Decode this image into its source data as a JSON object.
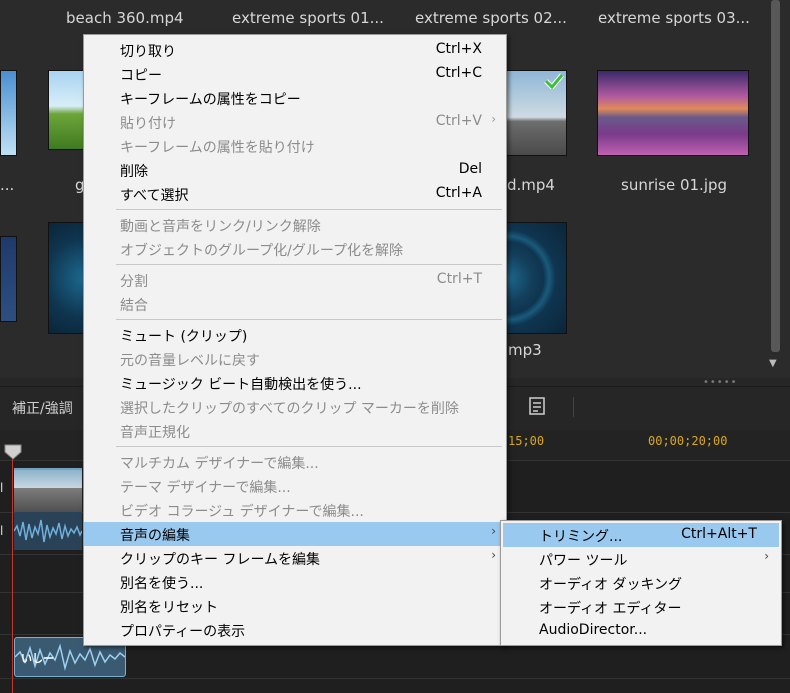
{
  "media": {
    "titles": [
      "beach 360.mp4",
      "extreme sports 01...",
      "extreme sports 02...",
      "extreme sports 03..."
    ],
    "captions": {
      "partial_left": "...",
      "partial_g": "g",
      "partial_mp4": "d.mp4",
      "sunrise": "sunrise 01.jpg",
      "partial_mp3": "mp3"
    }
  },
  "toolbar": {
    "label": "補正/強調"
  },
  "timeline": {
    "ruler_labels": [
      "15;00",
      "00;00;20;00"
    ],
    "audio_clip_label": "いしー"
  },
  "context_menu": {
    "groups": [
      [
        {
          "label": "切り取り",
          "shortcut": "Ctrl+X",
          "disabled": false
        },
        {
          "label": "コピー",
          "shortcut": "Ctrl+C",
          "disabled": false
        },
        {
          "label": "キーフレームの属性をコピー",
          "shortcut": "",
          "disabled": false
        },
        {
          "label": "貼り付け",
          "shortcut": "Ctrl+V",
          "disabled": true,
          "arrow": true
        },
        {
          "label": "キーフレームの属性を貼り付け",
          "shortcut": "",
          "disabled": true
        },
        {
          "label": "削除",
          "shortcut": "Del",
          "disabled": false
        },
        {
          "label": "すべて選択",
          "shortcut": "Ctrl+A",
          "disabled": false
        }
      ],
      [
        {
          "label": "動画と音声をリンク/リンク解除",
          "shortcut": "",
          "disabled": true
        },
        {
          "label": "オブジェクトのグループ化/グループ化を解除",
          "shortcut": "",
          "disabled": true
        }
      ],
      [
        {
          "label": "分割",
          "shortcut": "Ctrl+T",
          "disabled": true
        },
        {
          "label": "結合",
          "shortcut": "",
          "disabled": true
        }
      ],
      [
        {
          "label": "ミュート (クリップ)",
          "shortcut": "",
          "disabled": false
        },
        {
          "label": "元の音量レベルに戻す",
          "shortcut": "",
          "disabled": true
        },
        {
          "label": "ミュージック ビート自動検出を使う...",
          "shortcut": "",
          "disabled": false
        },
        {
          "label": "選択したクリップのすべてのクリップ マーカーを削除",
          "shortcut": "",
          "disabled": true
        },
        {
          "label": "音声正規化",
          "shortcut": "",
          "disabled": true
        }
      ],
      [
        {
          "label": "マルチカム デザイナーで編集...",
          "shortcut": "",
          "disabled": true
        },
        {
          "label": "テーマ デザイナーで編集...",
          "shortcut": "",
          "disabled": true
        },
        {
          "label": "ビデオ コラージュ デザイナーで編集...",
          "shortcut": "",
          "disabled": true
        },
        {
          "label": "音声の編集",
          "shortcut": "",
          "disabled": false,
          "arrow": true,
          "active": true
        },
        {
          "label": "クリップのキー フレームを編集",
          "shortcut": "",
          "disabled": false,
          "arrow": true
        },
        {
          "label": "別名を使う...",
          "shortcut": "",
          "disabled": false
        },
        {
          "label": "別名をリセット",
          "shortcut": "",
          "disabled": false
        },
        {
          "label": "プロパティーの表示",
          "shortcut": "",
          "disabled": false
        }
      ]
    ]
  },
  "sub_menu": {
    "items": [
      {
        "label": "トリミング...",
        "shortcut": "Ctrl+Alt+T",
        "active": true
      },
      {
        "label": "パワー ツール",
        "shortcut": "",
        "arrow": true
      },
      {
        "label": "オーディオ ダッキング",
        "shortcut": ""
      },
      {
        "label": "オーディオ エディター",
        "shortcut": ""
      },
      {
        "label": "AudioDirector...",
        "shortcut": ""
      }
    ]
  },
  "colors": {
    "menu_bg": "#f2f2f2",
    "menu_highlight": "#99c9ef",
    "ruler_text": "#d9a820",
    "playhead": "#c0392b"
  }
}
